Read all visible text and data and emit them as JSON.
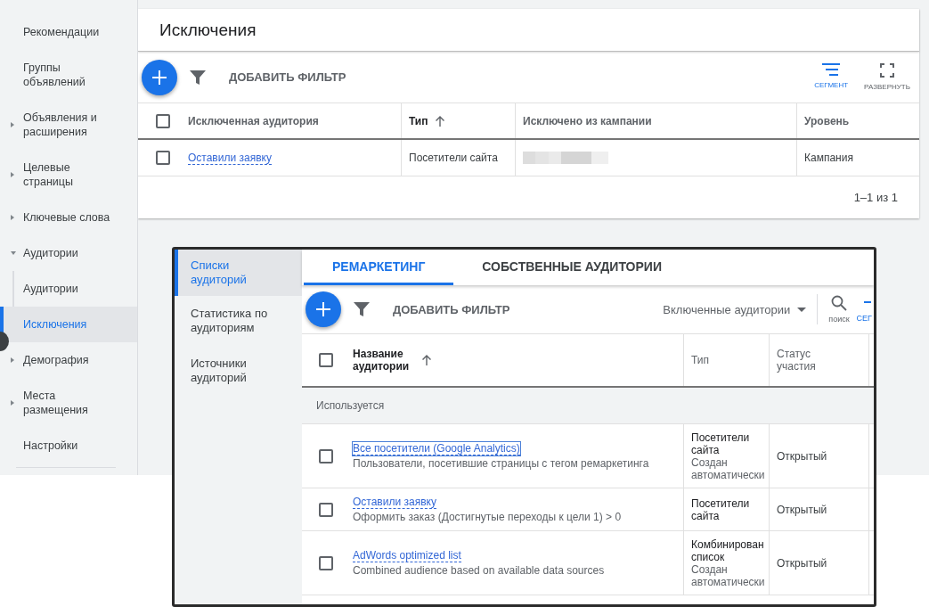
{
  "sidebar": {
    "items": [
      {
        "label": "Рекомендации",
        "kind": "plain",
        "selected": false
      },
      {
        "label": "Группы объявлений",
        "kind": "plain",
        "selected": false
      },
      {
        "label": "Объявления и расширения",
        "kind": "collapsed",
        "selected": false
      },
      {
        "label": "Целевые страницы",
        "kind": "collapsed",
        "selected": false
      },
      {
        "label": "Ключевые слова",
        "kind": "collapsed",
        "selected": false
      },
      {
        "label": "Аудитории",
        "kind": "expanded",
        "selected": false
      },
      {
        "label": "Аудитории",
        "kind": "sub",
        "selected": false
      },
      {
        "label": "Исключения",
        "kind": "sub",
        "selected": true
      },
      {
        "label": "Демография",
        "kind": "collapsed",
        "selected": false
      },
      {
        "label": "Места размещения",
        "kind": "collapsed",
        "selected": false
      },
      {
        "label": "Настройки",
        "kind": "plain",
        "selected": false
      }
    ]
  },
  "exclusions": {
    "title": "Исключения",
    "add_filter": "ДОБАВИТЬ ФИЛЬТР",
    "select_all_checked": false,
    "tools": [
      {
        "label": "СЕГМЕНТ",
        "kind": "segment",
        "active": true
      },
      {
        "label": "РАЗВЕРНУТЬ",
        "kind": "expand",
        "active": false
      }
    ],
    "columns": [
      {
        "label": "Исключенная аудитория",
        "sorted": false
      },
      {
        "label": "Тип",
        "sorted": true
      },
      {
        "label": "Исключено из кампании",
        "sorted": false
      },
      {
        "label": "Уровень",
        "sorted": false
      }
    ],
    "rows": [
      {
        "checked": false,
        "audience": "Оставили заявку",
        "type": "Посетители сайта",
        "level": "Кампания"
      }
    ],
    "pagination": "1–1 из 1"
  },
  "inset": {
    "nav": [
      {
        "label": "Списки аудиторий",
        "selected": true
      },
      {
        "label": "Статистика по аудиториям",
        "selected": false
      },
      {
        "label": "Источники аудиторий",
        "selected": false
      }
    ],
    "tabs": [
      {
        "label": "РЕМАРКЕТИНГ",
        "selected": true
      },
      {
        "label": "СОБСТВЕННЫЕ АУДИТОРИИ",
        "selected": false
      }
    ],
    "add_filter": "ДОБАВИТЬ ФИЛЬТР",
    "view_select": "Включенные аудитории",
    "search_label": "поиск",
    "segment_label": "СЕГ",
    "select_all_checked": false,
    "columns": [
      {
        "label": "Название аудитории",
        "sorted": true
      },
      {
        "label": "Тип",
        "sorted": false
      },
      {
        "label": "Статус участия",
        "sorted": false
      }
    ],
    "group": "Используется",
    "rows": [
      {
        "checked": false,
        "focused": true,
        "name": "Все посетители (Google Analytics)",
        "description": "Пользователи, посетившие страницы с тегом ремаркетинга",
        "type": "Посетители сайта",
        "type_note": "Создан автоматически",
        "status": "Открытый"
      },
      {
        "checked": false,
        "focused": false,
        "name": "Оставили заявку",
        "description": "Оформить заказ (Достигнутые переходы к цели 1) > 0",
        "type": "Посетители сайта",
        "status": "Открытый"
      },
      {
        "checked": false,
        "focused": false,
        "name": "AdWords optimized list",
        "description": "Combined audience based on available data sources",
        "type": "Комбинирован список",
        "type_note": "Создан автоматически",
        "status": "Открытый"
      }
    ]
  }
}
